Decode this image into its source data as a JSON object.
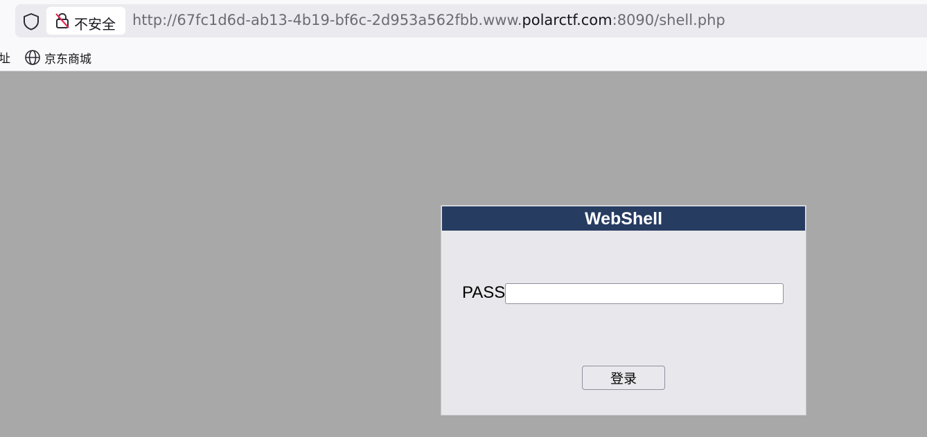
{
  "browser": {
    "security_label": "不安全",
    "url_prefix": "http://67fc1d6d-ab13-4b19-bf6c-2d953a562fbb.www.",
    "url_domain": "polarctf.com",
    "url_suffix": ":8090/shell.php",
    "bookmarks": {
      "partial_label": "址",
      "jd_label": "京东商城",
      "jd_icon": "globe-icon"
    },
    "icons": {
      "tracking": "shield-icon",
      "security": "insecure-lock-icon"
    }
  },
  "login": {
    "title": "WebShell",
    "pass_label": "PASS:",
    "pass_value": "",
    "submit_label": "登录"
  },
  "colors": {
    "header_bg": "#263c61",
    "panel_bg": "#e8e7ec",
    "page_bg": "#a8a8a8"
  }
}
